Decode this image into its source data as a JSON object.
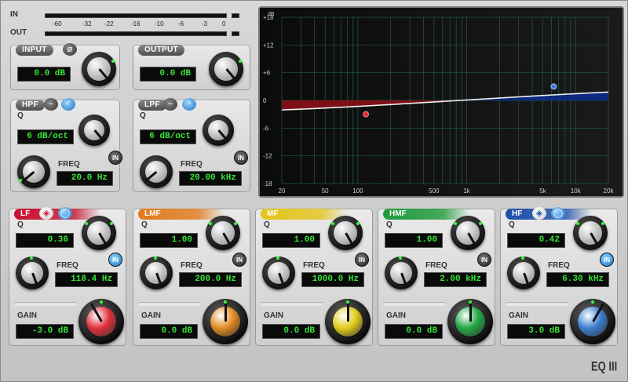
{
  "meter": {
    "in_label": "IN",
    "out_label": "OUT",
    "scale": [
      "-60",
      "-32",
      "-22",
      "-16",
      "-10",
      "-6",
      "-3",
      "0"
    ]
  },
  "input": {
    "title": "INPUT",
    "phase_icon": "phase-invert-icon",
    "value": "0.0 dB"
  },
  "output": {
    "title": "OUTPUT",
    "value": "0.0 dB"
  },
  "hpf": {
    "title": "HPF",
    "q_label": "Q",
    "q_value": "6 dB/oct",
    "freq_label": "FREQ",
    "freq_value": "20.0 Hz",
    "in_label": "IN"
  },
  "lpf": {
    "title": "LPF",
    "q_label": "Q",
    "q_value": "6 dB/oct",
    "freq_label": "FREQ",
    "freq_value": "20.00 kHz",
    "in_label": "IN"
  },
  "bands": [
    {
      "title": "LF",
      "q_label": "Q",
      "q_value": "0.36",
      "freq_label": "FREQ",
      "freq_value": "118.4 Hz",
      "gain_label": "GAIN",
      "gain_value": "-3.0 dB",
      "in_label": "IN",
      "in_active": true,
      "color": "#c8102e",
      "knob_color": "#e0303a"
    },
    {
      "title": "LMF",
      "q_label": "Q",
      "q_value": "1.00",
      "freq_label": "FREQ",
      "freq_value": "200.0 Hz",
      "gain_label": "GAIN",
      "gain_value": "0.0 dB",
      "in_label": "IN",
      "in_active": false,
      "color": "#e07a1a",
      "knob_color": "#e08a22"
    },
    {
      "title": "MF",
      "q_label": "Q",
      "q_value": "1.00",
      "freq_label": "FREQ",
      "freq_value": "1000.0 Hz",
      "gain_label": "GAIN",
      "gain_value": "0.0 dB",
      "in_label": "IN",
      "in_active": false,
      "color": "#e3c418",
      "knob_color": "#e3cc1a"
    },
    {
      "title": "HMF",
      "q_label": "Q",
      "q_value": "1.00",
      "freq_label": "FREQ",
      "freq_value": "2.00 kHz",
      "gain_label": "GAIN",
      "gain_value": "0.0 dB",
      "in_label": "IN",
      "in_active": false,
      "color": "#1f9a3a",
      "knob_color": "#22a844"
    },
    {
      "title": "HF",
      "q_label": "Q",
      "q_value": "0.42",
      "freq_label": "FREQ",
      "freq_value": "6.30 kHz",
      "gain_label": "GAIN",
      "gain_value": "3.0 dB",
      "in_label": "IN",
      "in_active": true,
      "color": "#1d4fa8",
      "knob_color": "#3a7fd0"
    }
  ],
  "graph": {
    "unit_label": "dB",
    "db_ticks": [
      "+18",
      "+12",
      "+6",
      "0",
      "-6",
      "-12",
      "-18"
    ],
    "freq_ticks": [
      "20",
      "50",
      "100",
      "500",
      "1k",
      "5k",
      "10k",
      "20k"
    ]
  },
  "product_name": "EQ III",
  "colors": {
    "lcd_text": "#36e536",
    "graph_bg": "#0c0c0c",
    "grid": "#1f5a52"
  }
}
